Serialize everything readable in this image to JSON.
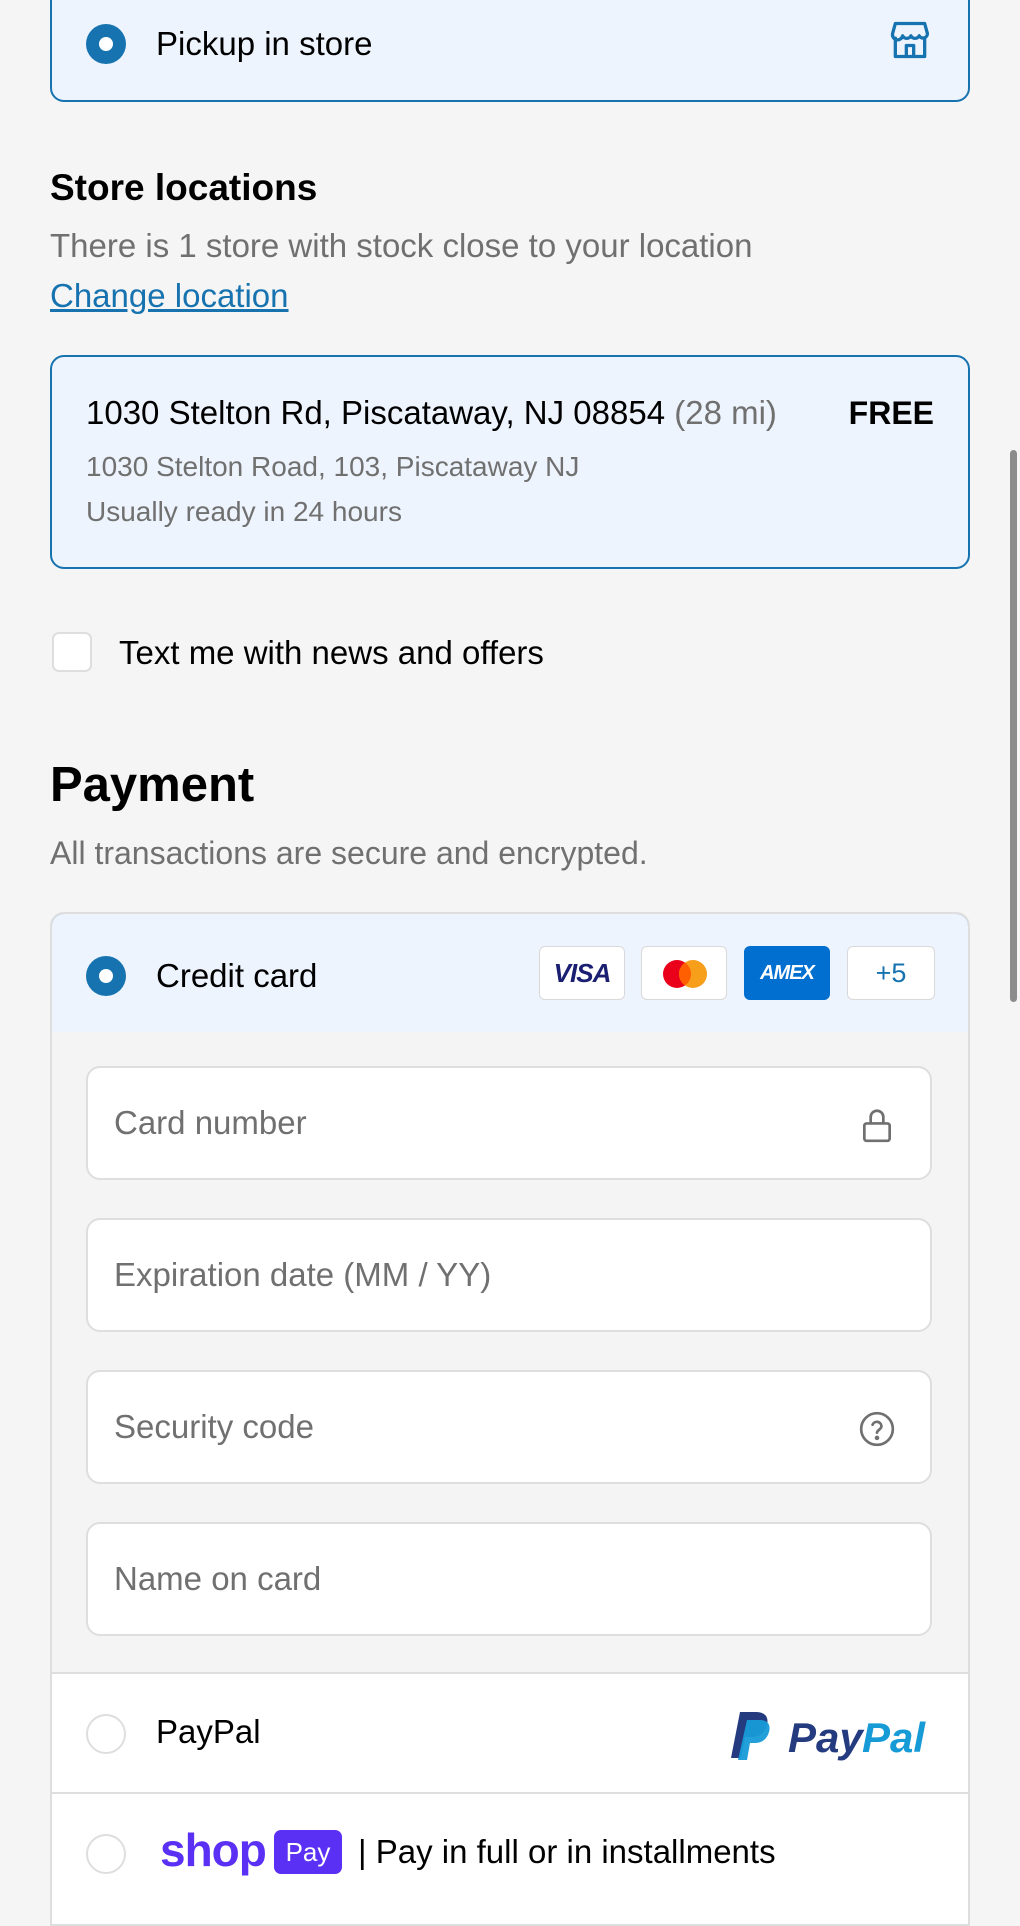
{
  "delivery": {
    "pickup_label": "Pickup in store",
    "store_icon": "store-icon"
  },
  "store_locations": {
    "title": "Store locations",
    "subtitle": "There is 1 store with stock close to your location",
    "change_link": "Change location",
    "store": {
      "name": "1030 Stelton Rd, Piscataway, NJ 08854",
      "distance": "(28 mi)",
      "price": "FREE",
      "address": "1030 Stelton Road, 103, Piscataway NJ",
      "ready": "Usually ready in 24 hours"
    }
  },
  "marketing": {
    "sms_label": "Text me with news and offers"
  },
  "payment": {
    "title": "Payment",
    "subtitle": "All transactions are secure and encrypted.",
    "credit_card": {
      "label": "Credit card",
      "badges": [
        "VISA",
        "AMEX"
      ],
      "more": "+5"
    },
    "fields": {
      "card_number": "Card number",
      "expiration": "Expiration date (MM / YY)",
      "security_code": "Security code",
      "name_on_card": "Name on card"
    },
    "paypal": {
      "label": "PayPal",
      "logo_text": "PayPal"
    },
    "shop_pay": {
      "wordmark": "shop",
      "badge": "Pay",
      "text": "| Pay in full or in installments"
    }
  },
  "colors": {
    "accent": "#1773b0",
    "selected_bg": "#eef4fd",
    "border": "#dedede",
    "muted_text": "#707070",
    "shop_purple": "#5a31f4",
    "paypal_dark": "#253b80",
    "paypal_light": "#179bd7"
  }
}
